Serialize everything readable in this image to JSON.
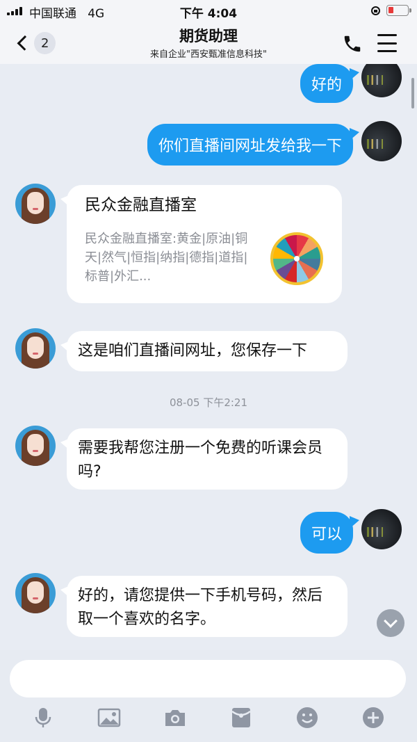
{
  "status_bar": {
    "carrier": "中国联通",
    "network": "4G",
    "time": "下午 4:04"
  },
  "nav": {
    "back_badge": "2",
    "title": "期货助理",
    "subtitle": "来自企业\"西安甄准信息科技\""
  },
  "messages": [
    {
      "side": "right",
      "text": "好的"
    },
    {
      "side": "right",
      "text": "你们直播间网址发给我一下"
    },
    {
      "side": "left",
      "type": "card",
      "title": "民众金融直播室",
      "description": "民众金融直播室:黄金|原油|铜天|然气|恒指|纳指|德指|道指|标普|外汇..."
    },
    {
      "side": "left",
      "text": "这是咱们直播间网址，您保存一下"
    },
    {
      "side": "left",
      "text": "需要我帮您注册一个免费的听课会员吗?"
    },
    {
      "side": "right",
      "text": "可以"
    },
    {
      "side": "left",
      "text": "好的，请您提供一下手机号码，然后取一个喜欢的名字。"
    }
  ],
  "timestamp": "08-05 下午2:21",
  "input": {
    "placeholder": ""
  },
  "toolbar": [
    "microphone-icon",
    "image-icon",
    "camera-icon",
    "red-packet-icon",
    "emoji-icon",
    "plus-icon"
  ],
  "colors": {
    "accent": "#1d9bf0",
    "background": "#e8ecf3",
    "icon_gray": "#8f96a3"
  }
}
